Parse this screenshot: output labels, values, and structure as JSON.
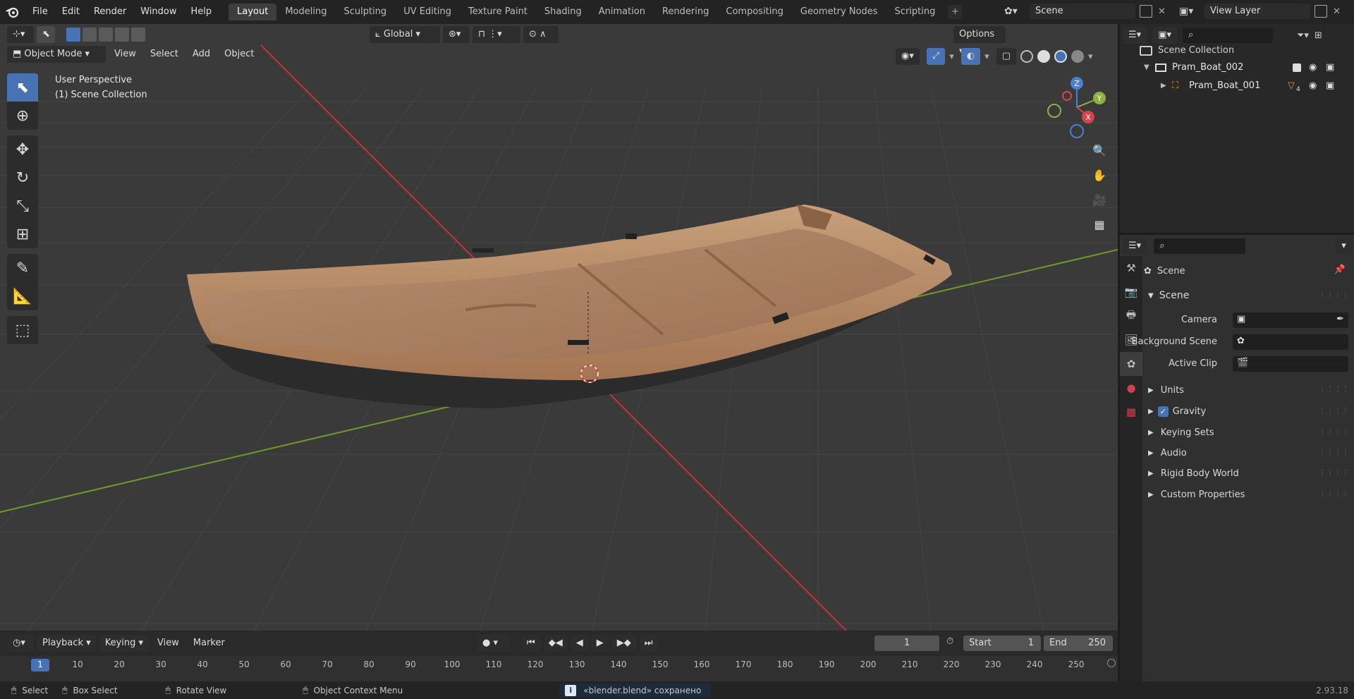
{
  "menu": [
    "File",
    "Edit",
    "Render",
    "Window",
    "Help"
  ],
  "workspaces": [
    "Layout",
    "Modeling",
    "Sculpting",
    "UV Editing",
    "Texture Paint",
    "Shading",
    "Animation",
    "Rendering",
    "Compositing",
    "Geometry Nodes",
    "Scripting"
  ],
  "scene_name": "Scene",
  "view_layer": "View Layer",
  "viewport": {
    "mode": "Object Mode",
    "menus": [
      "View",
      "Select",
      "Add",
      "Object"
    ],
    "transform_orientation": "Global",
    "options": "Options",
    "overlay_title": "User Perspective",
    "overlay_collection": "(1) Scene Collection",
    "gizmo_z": "Z",
    "gizmo_y": "Y",
    "gizmo_x": "X"
  },
  "outliner": {
    "root": "Scene Collection",
    "items": [
      {
        "label": "Pram_Boat_002"
      },
      {
        "label": "Pram_Boat_001",
        "badge": "4"
      }
    ]
  },
  "properties": {
    "context": "Scene",
    "panel": "Scene",
    "camera_label": "Camera",
    "background_label": "Background Scene",
    "clip_label": "Active Clip",
    "sections": [
      "Units",
      "Gravity",
      "Keying Sets",
      "Audio",
      "Rigid Body World",
      "Custom Properties"
    ],
    "gravity_checked": true
  },
  "timeline": {
    "menus": [
      "Playback",
      "Keying",
      "View",
      "Marker"
    ],
    "current_frame": "1",
    "start_label": "Start",
    "start": "1",
    "end_label": "End",
    "end": "250",
    "ticks": [
      "1",
      "10",
      "20",
      "30",
      "40",
      "50",
      "60",
      "70",
      "80",
      "90",
      "100",
      "110",
      "120",
      "130",
      "140",
      "150",
      "160",
      "170",
      "180",
      "190",
      "200",
      "210",
      "220",
      "230",
      "240",
      "250"
    ]
  },
  "status": {
    "select": "Select",
    "box_select": "Box Select",
    "rotate": "Rotate View",
    "context_menu": "Object Context Menu",
    "message": "«blender.blend» сохранено",
    "version": "2.93.18"
  },
  "colors": {
    "accent": "#4772b3",
    "x_axis": "#c8333b",
    "y_axis": "#6f9a2a",
    "boat_wood": "#b88e69"
  }
}
